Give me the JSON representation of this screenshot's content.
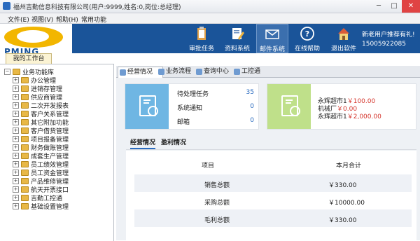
{
  "window": {
    "title": "福州吉勤信息科技有限公司(用户:9999,姓名:0,岗位:总经理)",
    "min": "─",
    "max": "□",
    "close": "✕"
  },
  "menu": [
    "文件(E)",
    "视图(V)",
    "帮助(H)",
    "常用功能"
  ],
  "logo_text": "PMING",
  "nav": [
    {
      "label": "审批任务",
      "icon": "clipboard-icon"
    },
    {
      "label": "资料系统",
      "icon": "edit-document-icon"
    },
    {
      "label": "邮件系统",
      "icon": "envelope-icon"
    },
    {
      "label": "在线帮助",
      "icon": "help-icon"
    },
    {
      "label": "退出软件",
      "icon": "exit-house-icon"
    }
  ],
  "promo": "新老用户推荐有礼!",
  "phone": "15005922085",
  "workbench_tab": "我的工作台",
  "tree": {
    "root": "业务功能库",
    "items": [
      "办公管理",
      "进销存管理",
      "供应商管理",
      "二次开发报表",
      "客户关系管理",
      "其它附加功能",
      "客户借货管理",
      "项目报备管理",
      "财务做账管理",
      "成套生产管理",
      "员工绩效管理",
      "员工资金管理",
      "产品维修管理",
      "航天开票接口",
      "吉勤工控通",
      "基础设置管理"
    ]
  },
  "tabs": [
    "经营情况",
    "业务流程",
    "查询中心",
    "工控通"
  ],
  "tasks": [
    {
      "label": "待处理任务",
      "count": "35"
    },
    {
      "label": "系统通知",
      "count": "0"
    },
    {
      "label": "邮箱",
      "count": "0"
    }
  ],
  "sales": [
    {
      "name": "永辉超市1",
      "amount": "￥100.00"
    },
    {
      "name": "机械厂",
      "amount": "￥0.00"
    },
    {
      "name": "永辉超市1",
      "amount": "￥2,000.00"
    }
  ],
  "subtabs": [
    "经营情况",
    "盈利情况"
  ],
  "table": {
    "headers": [
      "项目",
      "本月合计"
    ],
    "rows": [
      {
        "item": "销售总额",
        "value": "￥330.00"
      },
      {
        "item": "采购总额",
        "value": "￥10000.00"
      },
      {
        "item": "毛利总额",
        "value": "￥330.00"
      }
    ]
  },
  "colors": {
    "header_bg": "#1a5499",
    "task_card": "#6fb6e3",
    "sales_card": "#bfe08a",
    "amount": "#d4332a"
  }
}
